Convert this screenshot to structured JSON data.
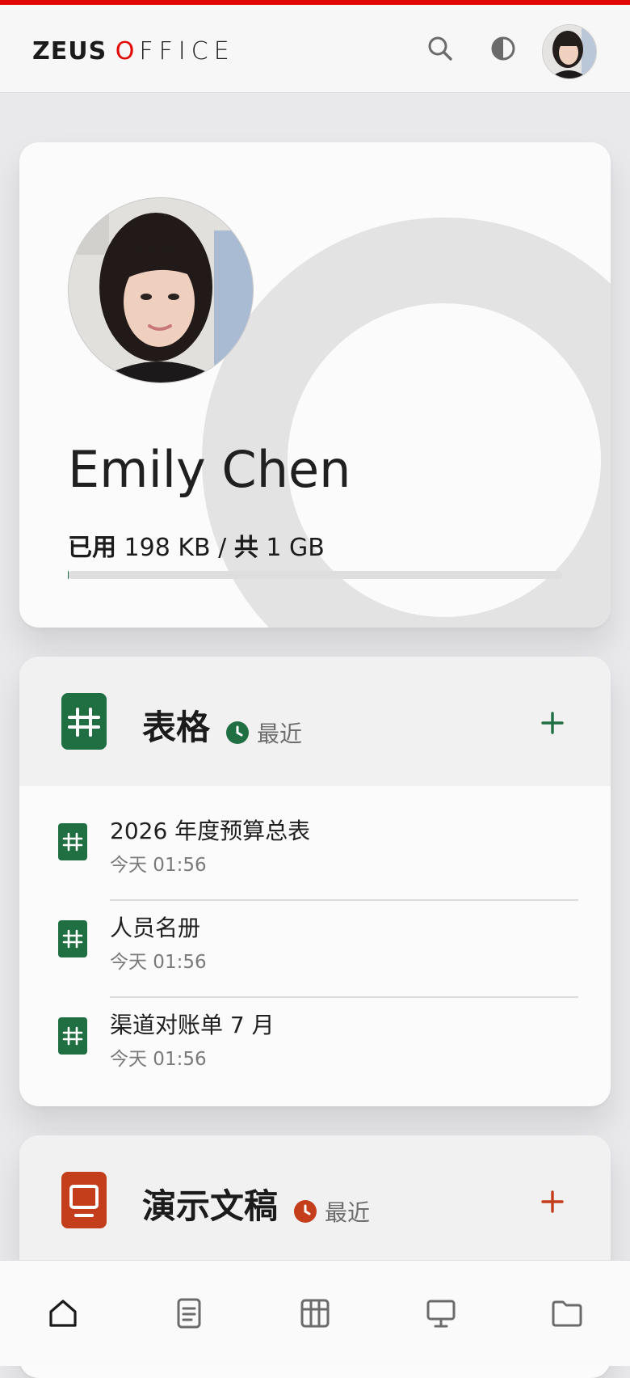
{
  "colors": {
    "accent_red": "#e10600",
    "sheets_green": "#1f6f43",
    "slides_orange": "#c43e1c"
  },
  "header": {
    "logo_bold": "ZEUS",
    "logo_o": "O",
    "logo_rest": "FFICE",
    "icons": [
      "search-icon",
      "theme-toggle-icon",
      "avatar"
    ]
  },
  "profile": {
    "name": "Emily Chen",
    "storage_used_label": "已用",
    "storage_used": "198 KB",
    "storage_sep": "/",
    "storage_total_label": "共",
    "storage_total": "1 GB",
    "usage_fraction": 0.0002
  },
  "sheets": {
    "title": "表格",
    "recent_label": "最近",
    "files": [
      {
        "name": "2026 年度预算总表",
        "date": "今天 01:56"
      },
      {
        "name": "人员名册",
        "date": "今天 01:56"
      },
      {
        "name": "渠道对账单 7 月",
        "date": "今天 01:56"
      }
    ]
  },
  "slides": {
    "title": "演示文稿",
    "recent_label": "最近"
  },
  "bottom_nav": [
    "home-icon",
    "documents-icon",
    "sheets-icon",
    "slides-icon",
    "folder-icon"
  ]
}
